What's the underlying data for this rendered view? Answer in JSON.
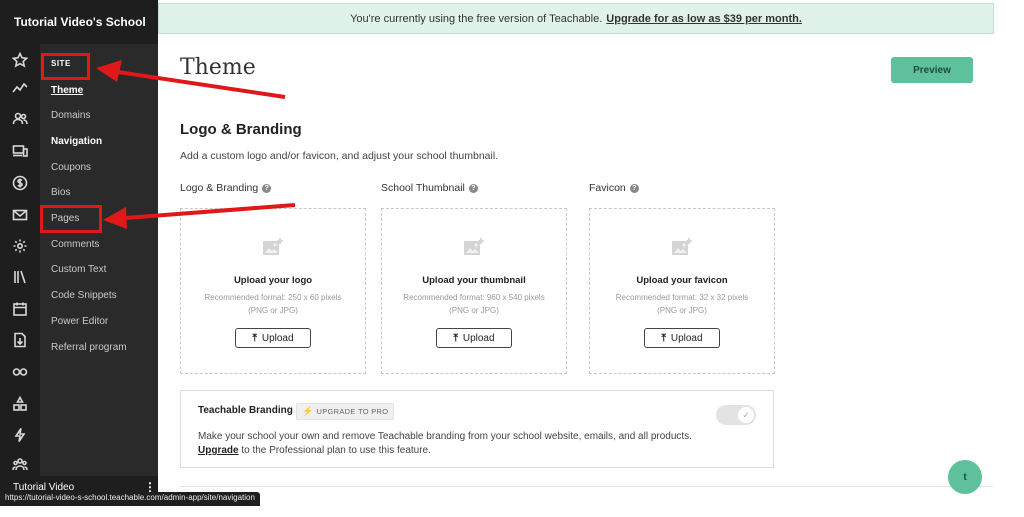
{
  "sidebar": {
    "school_name": "Tutorial Video's School",
    "icons": [
      "star-icon",
      "analytics-icon",
      "users-icon",
      "devices-icon",
      "dollar-icon",
      "mail-icon",
      "gear-icon",
      "library-icon",
      "calendar-icon",
      "download-icon",
      "key-icon",
      "affiliates-icon",
      "bolt-icon",
      "community-icon"
    ],
    "section_label": "SITE",
    "items": [
      {
        "label": "Theme"
      },
      {
        "label": "Domains"
      },
      {
        "label": "Navigation"
      },
      {
        "label": "Coupons"
      },
      {
        "label": "Bios"
      },
      {
        "label": "Pages"
      },
      {
        "label": "Comments"
      },
      {
        "label": "Custom Text"
      },
      {
        "label": "Code Snippets"
      },
      {
        "label": "Power Editor"
      },
      {
        "label": "Referral program"
      }
    ],
    "footer_name": "Tutorial Video",
    "kebab": "⋮"
  },
  "status_url": "https://tutorial-video-s-school.teachable.com/admin-app/site/navigation",
  "banner": {
    "text": "You're currently using the free version of Teachable.",
    "link": "Upgrade for as low as $39 per month."
  },
  "header": {
    "title": "Theme",
    "preview_label": "Preview"
  },
  "logo_branding": {
    "title": "Logo & Branding",
    "description": "Add a custom logo and/or favicon, and adjust your school thumbnail.",
    "cards": [
      {
        "label": "Logo & Branding",
        "title": "Upload your logo",
        "format": "Recommended format: 250 x 60 pixels",
        "types": "(PNG or JPG)",
        "button": "Upload"
      },
      {
        "label": "School Thumbnail",
        "title": "Upload your thumbnail",
        "format": "Recommended format: 960 x 540 pixels",
        "types": "(PNG or JPG)",
        "button": "Upload"
      },
      {
        "label": "Favicon",
        "title": "Upload your favicon",
        "format": "Recommended format: 32 x 32 pixels",
        "types": "(PNG or JPG)",
        "button": "Upload"
      }
    ]
  },
  "teachable_branding": {
    "title": "Teachable Branding",
    "badge": "UPGRADE TO PRO",
    "description": "Make your school your own and remove Teachable branding from your school website, emails, and all products.",
    "upgrade_link": "Upgrade",
    "upgrade_text": " to the Professional plan to use this feature.",
    "toggle_on": false
  },
  "chat": {
    "label": "t"
  },
  "colors": {
    "accent": "#5ec19b",
    "annotation": "#e01818",
    "sidebar": "#1e1e1e"
  }
}
